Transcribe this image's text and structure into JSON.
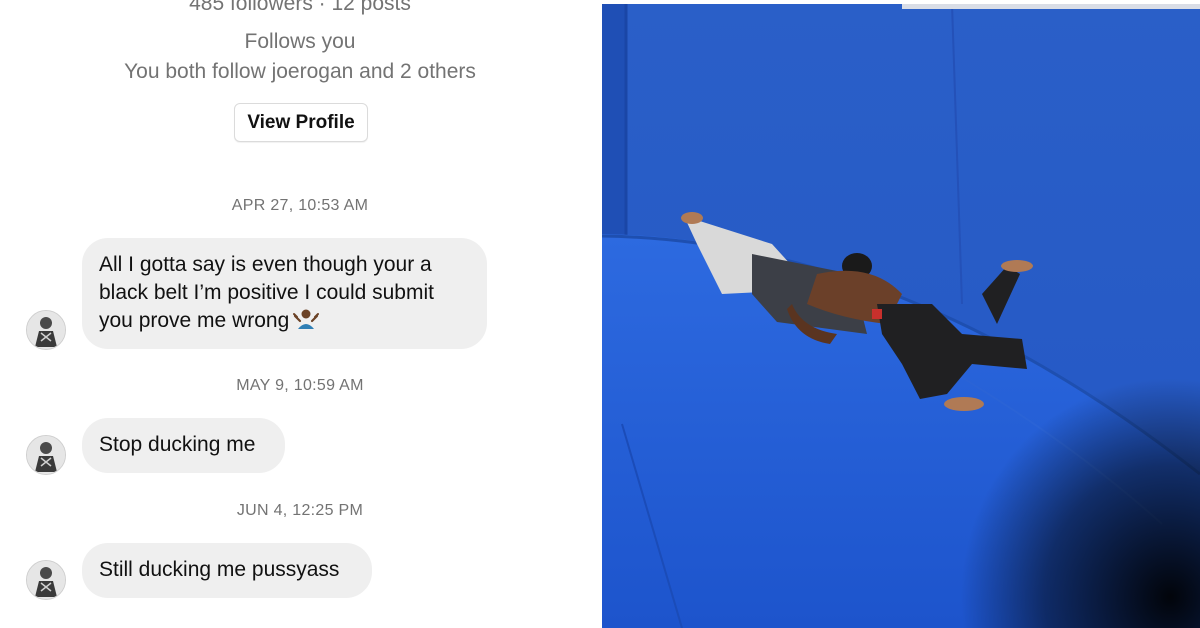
{
  "profile": {
    "stats": "485 followers · 12 posts",
    "follows_status": "Follows you",
    "mutual": "You both follow joerogan and 2 others",
    "view_profile_label": "View Profile"
  },
  "messages": [
    {
      "timestamp": "APR 27, 10:53 AM",
      "text": "All I gotta say is even though your a black belt I’m positive I could submit you prove me wrong",
      "emoji": "person-shrugging-emoji"
    },
    {
      "timestamp": "MAY 9, 10:59 AM",
      "text": "Stop ducking me"
    },
    {
      "timestamp": "JUN 4, 12:25 PM",
      "text": "Still ducking me pussyass"
    }
  ],
  "colors": {
    "bubble": "#efefef",
    "muted_text": "#737373",
    "mat_blue": "#1f5fd6",
    "wall_blue": "#2a60cc"
  }
}
